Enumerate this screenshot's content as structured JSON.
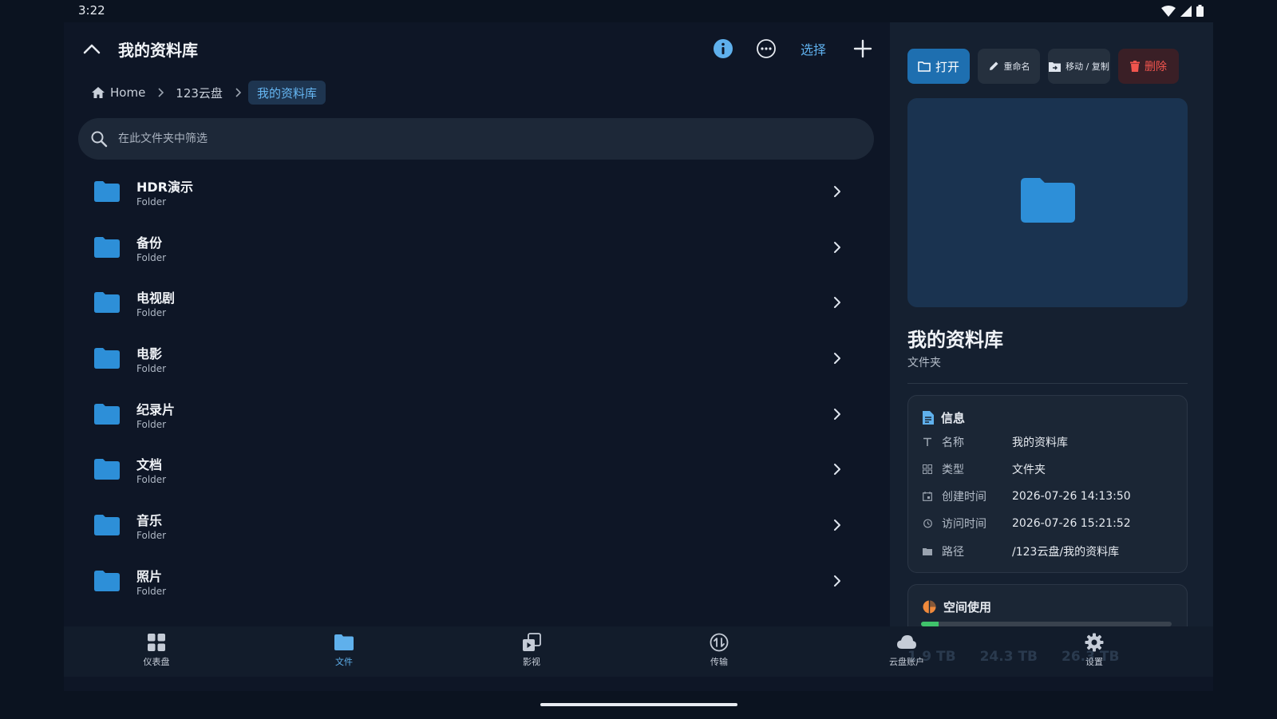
{
  "status": {
    "time": "3:22"
  },
  "header": {
    "title": "我的资料库",
    "select_label": "选择"
  },
  "breadcrumb": [
    {
      "label": "Home"
    },
    {
      "label": "123云盘"
    },
    {
      "label": "我的资料库"
    }
  ],
  "search": {
    "placeholder": "在此文件夹中筛选",
    "value": ""
  },
  "folders": [
    {
      "name": "HDR演示",
      "type": "Folder"
    },
    {
      "name": "备份",
      "type": "Folder"
    },
    {
      "name": "电视剧",
      "type": "Folder"
    },
    {
      "name": "电影",
      "type": "Folder"
    },
    {
      "name": "纪录片",
      "type": "Folder"
    },
    {
      "name": "文档",
      "type": "Folder"
    },
    {
      "name": "音乐",
      "type": "Folder"
    },
    {
      "name": "照片",
      "type": "Folder"
    }
  ],
  "actions": {
    "open": "打开",
    "rename": "重命名",
    "move": "移动 / 复制",
    "delete": "删除"
  },
  "details": {
    "name": "我的资料库",
    "type": "文件夹",
    "info_title": "信息",
    "rows": [
      {
        "label": "名称",
        "value": "我的资料库",
        "icon": "text-icon"
      },
      {
        "label": "类型",
        "value": "文件夹",
        "icon": "grid-icon"
      },
      {
        "label": "创建时间",
        "value": "2026-07-26 14:13:50",
        "icon": "calendar-icon"
      },
      {
        "label": "访问时间",
        "value": "2026-07-26 15:21:52",
        "icon": "history-icon"
      },
      {
        "label": "路径",
        "value": "/123云盘/我的资料库",
        "icon": "folder-icon"
      }
    ],
    "space_title": "空间使用",
    "space_fraction": 0.07,
    "space_values": [
      "1.9 TB",
      "24.3 TB",
      "26.3 TB"
    ]
  },
  "nav": [
    {
      "label": "仪表盘",
      "icon": "dashboard-icon"
    },
    {
      "label": "文件",
      "icon": "folder-icon",
      "active": true
    },
    {
      "label": "影视",
      "icon": "media-icon"
    },
    {
      "label": "传输",
      "icon": "transfer-icon"
    },
    {
      "label": "云盘账户",
      "icon": "cloud-icon"
    },
    {
      "label": "设置",
      "icon": "gear-icon"
    }
  ],
  "colors": {
    "accent": "#5fb0ec",
    "folder": "#2d8fd8",
    "danger": "#f2554e",
    "background": "#0e1626"
  }
}
